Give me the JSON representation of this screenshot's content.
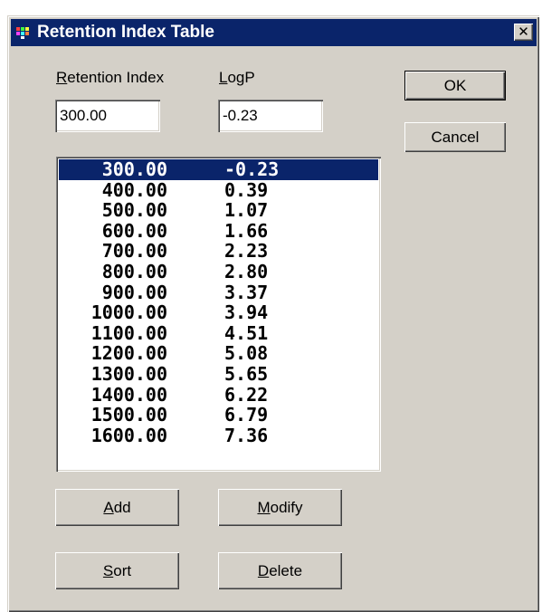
{
  "window": {
    "title": "Retention Index Table",
    "close_label": "✕"
  },
  "fields": {
    "ri_label_mnemonic": "R",
    "ri_label_rest": "etention Index",
    "ri_value": "300.00",
    "logp_label_mnemonic": "L",
    "logp_label_rest": "ogP",
    "logp_value": "-0.23"
  },
  "buttons": {
    "ok": "OK",
    "cancel": "Cancel",
    "add_mnemonic": "A",
    "add_rest": "dd",
    "modify_mnemonic": "M",
    "modify_rest": "odify",
    "sort_mnemonic": "S",
    "sort_rest": "ort",
    "delete_mnemonic": "D",
    "delete_rest": "elete"
  },
  "list": {
    "selected_index": 0,
    "rows": [
      {
        "ri": "300.00",
        "logp": "-0.23"
      },
      {
        "ri": "400.00",
        "logp": "0.39"
      },
      {
        "ri": "500.00",
        "logp": "1.07"
      },
      {
        "ri": "600.00",
        "logp": "1.66"
      },
      {
        "ri": "700.00",
        "logp": "2.23"
      },
      {
        "ri": "800.00",
        "logp": "2.80"
      },
      {
        "ri": "900.00",
        "logp": "3.37"
      },
      {
        "ri": "1000.00",
        "logp": "3.94"
      },
      {
        "ri": "1100.00",
        "logp": "4.51"
      },
      {
        "ri": "1200.00",
        "logp": "5.08"
      },
      {
        "ri": "1300.00",
        "logp": "5.65"
      },
      {
        "ri": "1400.00",
        "logp": "6.22"
      },
      {
        "ri": "1500.00",
        "logp": "6.79"
      },
      {
        "ri": "1600.00",
        "logp": "7.36"
      }
    ]
  },
  "colors": {
    "titlebar": "#0a246a",
    "face": "#d4d0c8",
    "selection": "#0a246a"
  },
  "icons": {
    "app": "app-icon",
    "close": "close-icon"
  }
}
